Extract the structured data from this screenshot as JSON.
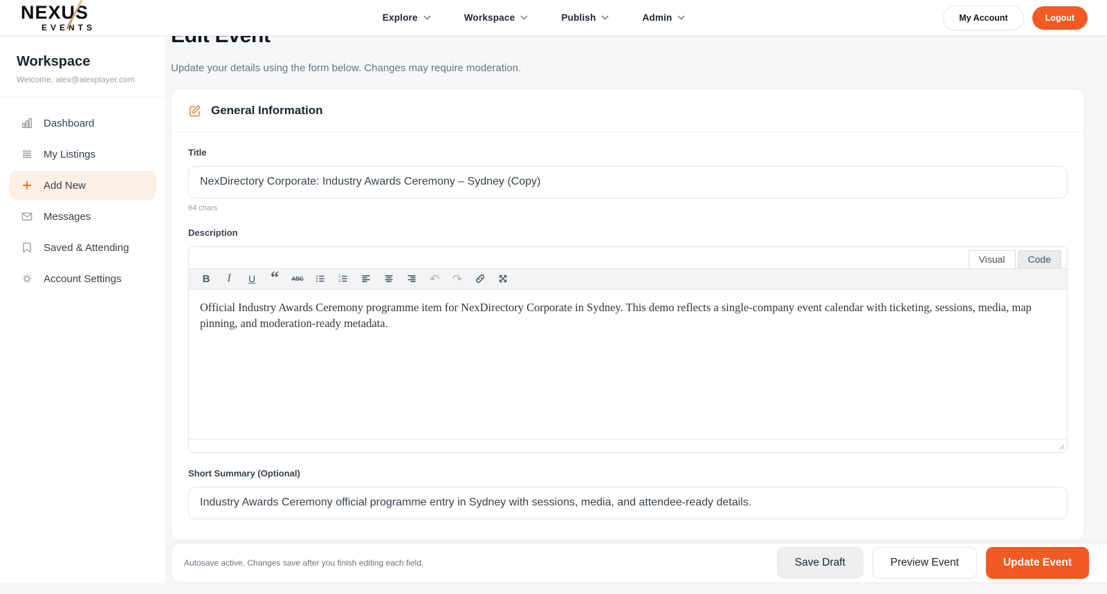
{
  "colors": {
    "accent": "#f15a22",
    "accent_soft": "#fcefe3",
    "logo_slash_gold": "#c9a06a"
  },
  "brand": {
    "name_top": "NEXUS",
    "name_bottom": "EVENTS"
  },
  "navbar": {
    "menus": [
      {
        "label": "Explore"
      },
      {
        "label": "Workspace"
      },
      {
        "label": "Publish"
      },
      {
        "label": "Admin"
      }
    ],
    "my_account_label": "My Account",
    "logout_label": "Logout"
  },
  "sidebar": {
    "title": "Workspace",
    "welcome": "Welcome, alex@alexplayer.com",
    "items": [
      {
        "label": "Dashboard",
        "icon": "bar-chart-icon",
        "active": false
      },
      {
        "label": "My Listings",
        "icon": "list-icon",
        "active": false
      },
      {
        "label": "Add New",
        "icon": "plus-icon",
        "active": true
      },
      {
        "label": "Messages",
        "icon": "envelope-icon",
        "active": false
      },
      {
        "label": "Saved & Attending",
        "icon": "bookmark-icon",
        "active": false
      },
      {
        "label": "Account Settings",
        "icon": "gear-icon",
        "active": false
      }
    ]
  },
  "page": {
    "title": "Edit Event",
    "subtitle": "Update your details using the form below. Changes may require moderation."
  },
  "form": {
    "section_title": "General Information",
    "title_field": {
      "label": "Title",
      "value": "NexDirectory Corporate: Industry Awards Ceremony – Sydney (Copy)",
      "helper": "64 chars"
    },
    "description_field": {
      "label": "Description",
      "tabs": [
        {
          "label": "Visual",
          "active": true
        },
        {
          "label": "Code",
          "active": false
        }
      ],
      "toolbar": [
        {
          "name": "bold",
          "glyph": "B"
        },
        {
          "name": "italic",
          "glyph": "I"
        },
        {
          "name": "underline",
          "glyph": "U"
        },
        {
          "name": "blockquote",
          "glyph": "“"
        },
        {
          "name": "strikethrough",
          "glyph": "ABC"
        },
        {
          "name": "bullet-list"
        },
        {
          "name": "numbered-list"
        },
        {
          "name": "align-left"
        },
        {
          "name": "align-center"
        },
        {
          "name": "align-right"
        },
        {
          "name": "undo",
          "glyph": "↶"
        },
        {
          "name": "redo",
          "glyph": "↷"
        },
        {
          "name": "link"
        },
        {
          "name": "fullscreen"
        }
      ],
      "content": "Official Industry Awards Ceremony programme item for NexDirectory Corporate in Sydney. This demo reflects a single-company event calendar with ticketing, sessions, media, map pinning, and moderation-ready metadata."
    },
    "summary_field": {
      "label": "Short Summary (Optional)",
      "value": "Industry Awards Ceremony official programme entry in Sydney with sessions, media, and attendee-ready details."
    }
  },
  "footer": {
    "autosave_note": "Autosave active. Changes save after you finish editing each field.",
    "buttons": [
      {
        "label": "Save Draft",
        "style": "neutral"
      },
      {
        "label": "Preview Event",
        "style": "outline"
      },
      {
        "label": "Update Event",
        "style": "primary"
      }
    ]
  }
}
